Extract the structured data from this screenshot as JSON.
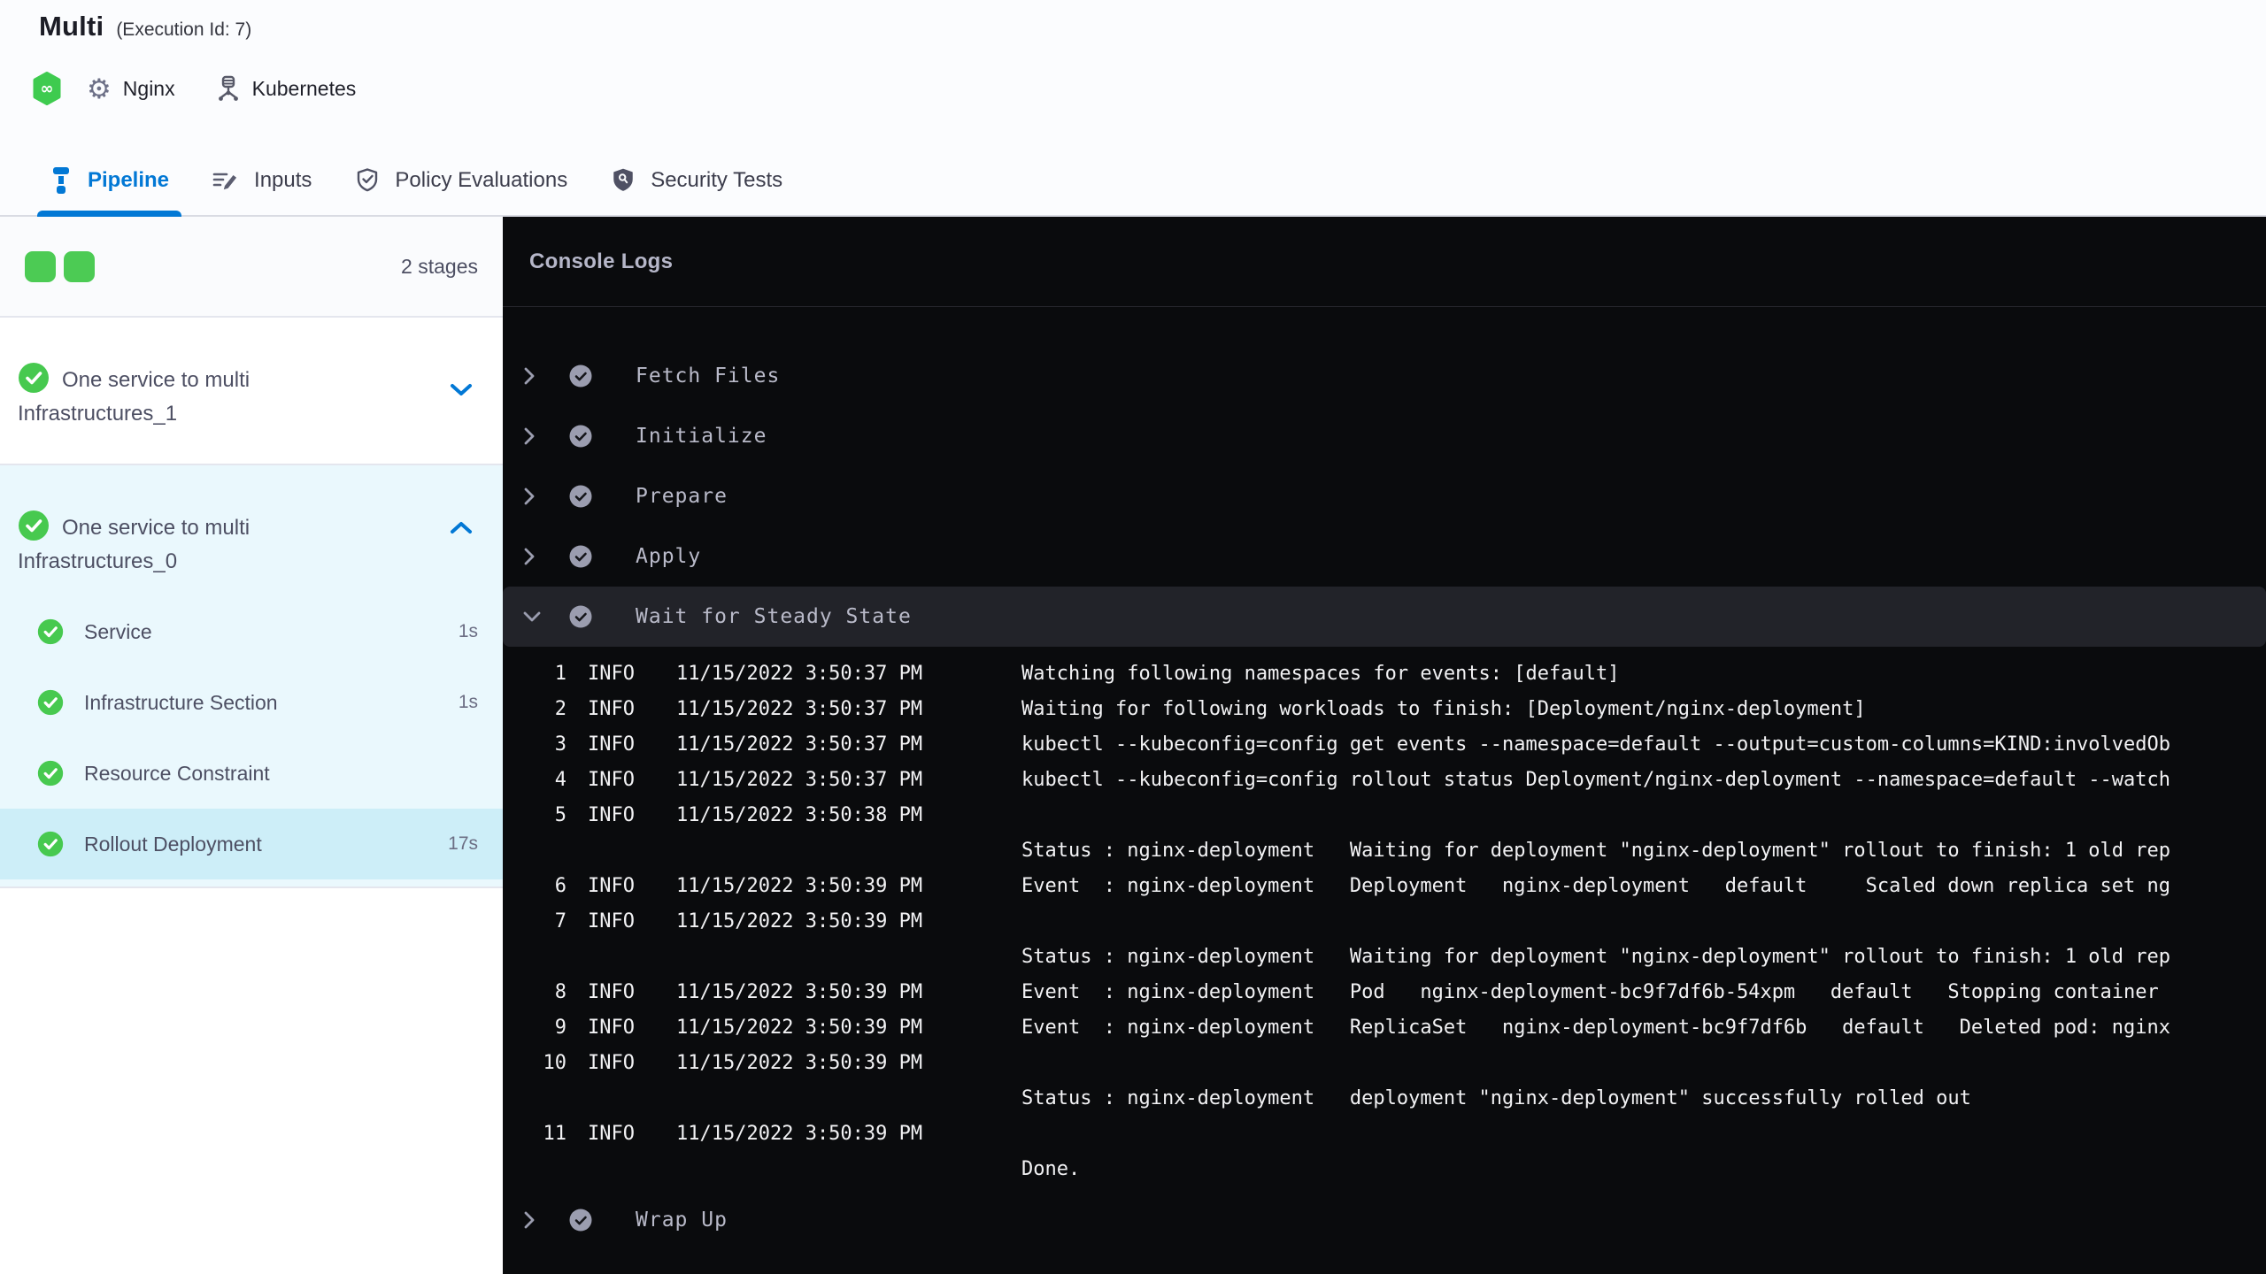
{
  "header": {
    "title": "Multi",
    "execution_id": "(Execution Id: 7)",
    "service_label": "Nginx",
    "infrastructure_label": "Kubernetes"
  },
  "tabs": [
    {
      "label": "Pipeline",
      "active": true
    },
    {
      "label": "Inputs",
      "active": false
    },
    {
      "label": "Policy Evaluations",
      "active": false
    },
    {
      "label": "Security Tests",
      "active": false
    }
  ],
  "sidebar": {
    "stage_count_label": "2 stages",
    "stages": [
      {
        "name": "One service to multi Infrastructures_1",
        "status": "success",
        "expanded": false
      },
      {
        "name": "One service to multi Infrastructures_0",
        "status": "success",
        "expanded": true,
        "steps": [
          {
            "name": "Service",
            "duration": "1s",
            "status": "success"
          },
          {
            "name": "Infrastructure Section",
            "duration": "1s",
            "status": "success"
          },
          {
            "name": "Resource Constraint",
            "duration": "",
            "status": "success"
          },
          {
            "name": "Rollout Deployment",
            "duration": "17s",
            "status": "success",
            "selected": true
          }
        ]
      }
    ]
  },
  "console": {
    "title": "Console Logs",
    "steps": [
      {
        "name": "Fetch Files",
        "status": "success",
        "expanded": false
      },
      {
        "name": "Initialize",
        "status": "success",
        "expanded": false
      },
      {
        "name": "Prepare",
        "status": "success",
        "expanded": false
      },
      {
        "name": "Apply",
        "status": "success",
        "expanded": false
      },
      {
        "name": "Wait for Steady State",
        "status": "success",
        "expanded": true
      },
      {
        "name": "Wrap Up",
        "status": "success",
        "expanded": false
      }
    ],
    "logs": [
      {
        "num": "1",
        "level": "INFO",
        "ts": "11/15/2022 3:50:37 PM",
        "msg": "Watching following namespaces for events: [default]"
      },
      {
        "num": "2",
        "level": "INFO",
        "ts": "11/15/2022 3:50:37 PM",
        "msg": "Waiting for following workloads to finish: [Deployment/nginx-deployment]"
      },
      {
        "num": "3",
        "level": "INFO",
        "ts": "11/15/2022 3:50:37 PM",
        "msg": "kubectl --kubeconfig=config get events --namespace=default --output=custom-columns=KIND:involvedOb"
      },
      {
        "num": "4",
        "level": "INFO",
        "ts": "11/15/2022 3:50:37 PM",
        "msg": "kubectl --kubeconfig=config rollout status Deployment/nginx-deployment --namespace=default --watch"
      },
      {
        "num": "5",
        "level": "INFO",
        "ts": "11/15/2022 3:50:38 PM",
        "msg": ""
      },
      {
        "num": "",
        "level": "",
        "ts": "",
        "msg": "Status : nginx-deployment   Waiting for deployment \"nginx-deployment\" rollout to finish: 1 old rep"
      },
      {
        "num": "6",
        "level": "INFO",
        "ts": "11/15/2022 3:50:39 PM",
        "msg": "Event  : nginx-deployment   Deployment   nginx-deployment   default     Scaled down replica set ng"
      },
      {
        "num": "7",
        "level": "INFO",
        "ts": "11/15/2022 3:50:39 PM",
        "msg": ""
      },
      {
        "num": "",
        "level": "",
        "ts": "",
        "msg": "Status : nginx-deployment   Waiting for deployment \"nginx-deployment\" rollout to finish: 1 old rep"
      },
      {
        "num": "8",
        "level": "INFO",
        "ts": "11/15/2022 3:50:39 PM",
        "msg": "Event  : nginx-deployment   Pod   nginx-deployment-bc9f7df6b-54xpm   default   Stopping container"
      },
      {
        "num": "9",
        "level": "INFO",
        "ts": "11/15/2022 3:50:39 PM",
        "msg": "Event  : nginx-deployment   ReplicaSet   nginx-deployment-bc9f7df6b   default   Deleted pod: nginx"
      },
      {
        "num": "10",
        "level": "INFO",
        "ts": "11/15/2022 3:50:39 PM",
        "msg": ""
      },
      {
        "num": "",
        "level": "",
        "ts": "",
        "msg": "Status : nginx-deployment   deployment \"nginx-deployment\" successfully rolled out"
      },
      {
        "num": "11",
        "level": "INFO",
        "ts": "11/15/2022 3:50:39 PM",
        "msg": ""
      },
      {
        "num": "",
        "level": "",
        "ts": "",
        "msg": "Done."
      }
    ]
  },
  "icons": {
    "harness-hexagon-icon": "green hexagon with infinity",
    "gear-icon": "⚙",
    "kubernetes-icon": "service cylinder with legs",
    "pipeline-icon": "pipeline nodes",
    "inputs-icon": "pencil with lines",
    "policy-evaluations-icon": "shield with check",
    "security-tests-icon": "filled shield with scanner",
    "success-check-icon": "circled check",
    "chevron-down-icon": "v",
    "chevron-up-icon": "^",
    "chevron-right-icon": ">"
  },
  "colors": {
    "accent_blue": "#0278d5",
    "success_green": "#4ccb54",
    "console_bg": "#0a0b0d",
    "expanded_stage_bg": "#eaf8fd",
    "selected_step_bg": "#cdeef8",
    "console_selected_row_bg": "#222329"
  }
}
